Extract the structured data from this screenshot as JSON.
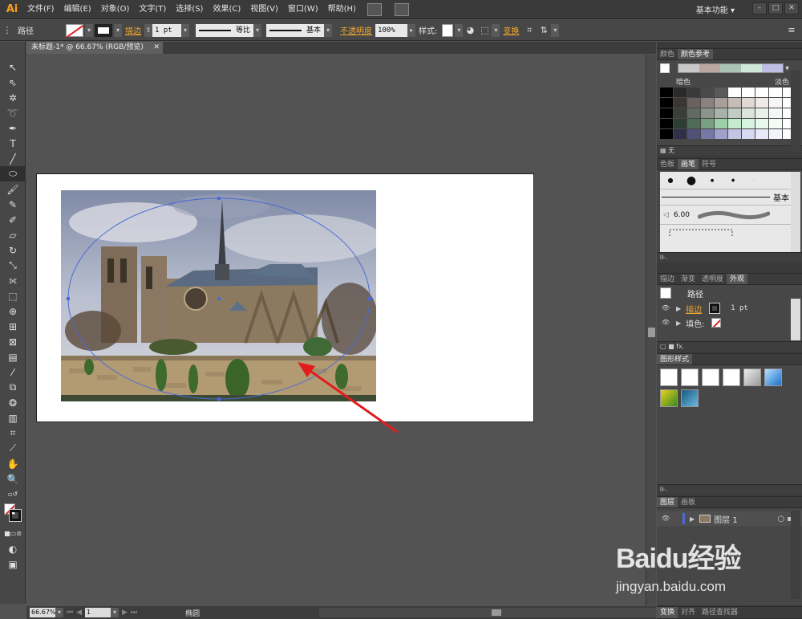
{
  "app": {
    "logo": "Ai"
  },
  "menu": {
    "items": [
      "文件(F)",
      "编辑(E)",
      "对象(O)",
      "文字(T)",
      "选择(S)",
      "效果(C)",
      "视图(V)",
      "窗口(W)",
      "帮助(H)"
    ]
  },
  "workspace": {
    "label": "基本功能",
    "chevron": "▾"
  },
  "window_controls": {
    "minimize": "–",
    "maximize": "□",
    "close": "✕"
  },
  "control_bar": {
    "selection": "路径",
    "stroke_link": "描边",
    "stroke_weight": "1 pt",
    "profile_label": "等比",
    "brush_label": "基本",
    "opacity_link": "不透明度",
    "opacity_value": "100%",
    "style_label": "样式:",
    "transform_link": "变换"
  },
  "document": {
    "tab_title": "未标题-1* @ 66.67% (RGB/预览)",
    "close": "✕"
  },
  "status": {
    "zoom": "66.67%",
    "artboard": "1",
    "tool_name": "椭圆"
  },
  "panels": {
    "color_guide": {
      "tabs": [
        "颜色",
        "颜色参考"
      ],
      "dark_label": "暗色",
      "light_label": "淡色",
      "none_label": "无",
      "guide_colors": [
        "#c8c8c8",
        "#b9a7a0",
        "#a9c4b2",
        "#cfe8d8",
        "#bfbfe6"
      ],
      "grid": [
        [
          "#000000",
          "#2a2a2a",
          "#3a3a3a",
          "#4a4a4a",
          "#5a5a5a",
          "#ffffff",
          "#ffffff",
          "#ffffff",
          "#ffffff",
          "#ffffff"
        ],
        [
          "#000000",
          "#3a3632",
          "#6a625e",
          "#8a827e",
          "#a89e9a",
          "#c8bcb8",
          "#e0d8d4",
          "#eeeae8",
          "#f8f6f4",
          "#ffffff"
        ],
        [
          "#000000",
          "#3a3e38",
          "#626a64",
          "#8a948c",
          "#a8b2aa",
          "#c2ccc4",
          "#dce4de",
          "#eaf0ec",
          "#f4f8f6",
          "#ffffff"
        ],
        [
          "#000000",
          "#2e3e34",
          "#4e6a58",
          "#76a080",
          "#9cd0a8",
          "#c4eccc",
          "#d8f4de",
          "#e8f8ec",
          "#f4fcf6",
          "#ffffff"
        ],
        [
          "#000000",
          "#30304a",
          "#505078",
          "#7878a8",
          "#a0a0cc",
          "#c4c4e4",
          "#d8d8f0",
          "#e8e8f6",
          "#f4f4fc",
          "#ffffff"
        ]
      ]
    },
    "brushes": {
      "tabs": [
        "色板",
        "画笔",
        "符号"
      ],
      "basic_label": "基本",
      "size_label": "6.00"
    },
    "appearance": {
      "tabs": [
        "描边",
        "渐变",
        "透明度",
        "外观"
      ],
      "title": "路径",
      "stroke_link": "描边",
      "stroke_value": "1 pt",
      "fill_label": "填色:",
      "fx_label": "fx."
    },
    "graphic_styles": {
      "tabs": [
        "图形样式"
      ]
    },
    "layers": {
      "tabs": [
        "图层",
        "画板"
      ],
      "layer_name": "图层 1"
    },
    "bottom": {
      "tabs": [
        "变换",
        "对齐",
        "路径查找器"
      ]
    }
  },
  "watermark": {
    "brand": "Baidu经验",
    "url": "jingyan.baidu.com"
  }
}
